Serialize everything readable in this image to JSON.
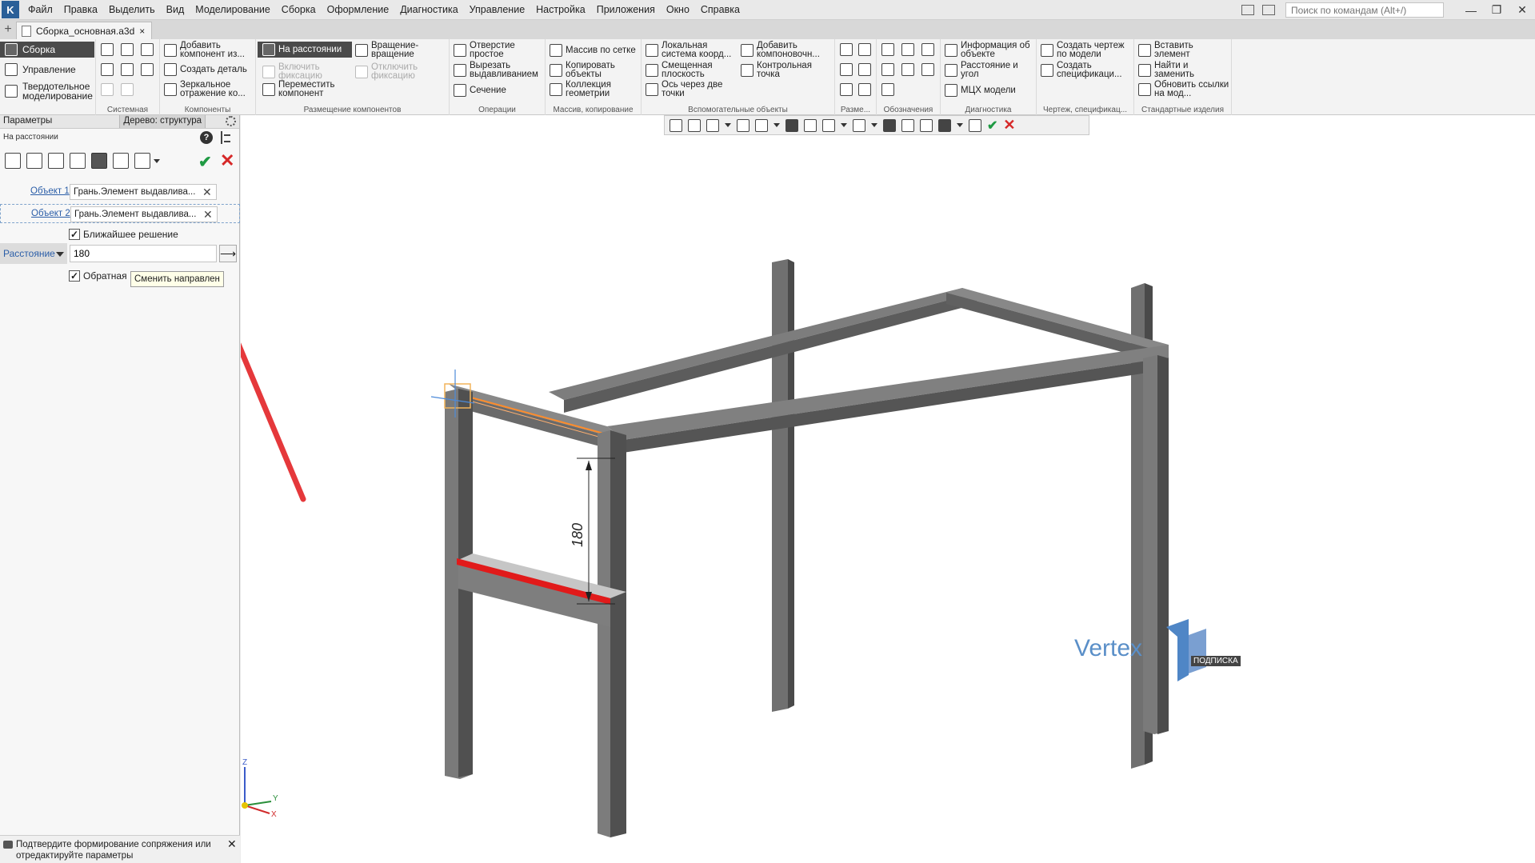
{
  "menu": {
    "items": [
      "Файл",
      "Правка",
      "Выделить",
      "Вид",
      "Моделирование",
      "Сборка",
      "Оформление",
      "Диагностика",
      "Управление",
      "Настройка",
      "Приложения",
      "Окно",
      "Справка"
    ],
    "search_placeholder": "Поиск по командам (Alt+/)"
  },
  "tab": {
    "title": "Сборка_основная.a3d",
    "close": "×",
    "new": "+"
  },
  "ribbon": {
    "modes": [
      {
        "label": "Сборка"
      },
      {
        "label": "Управление"
      },
      {
        "label": "Твердотельное моделирование"
      }
    ],
    "groups": {
      "system": "Системная",
      "components": "Компоненты",
      "placement": "Размещение компонентов",
      "operations": "Операции",
      "array": "Массив, копирование",
      "aux": "Вспомогательные объекты",
      "dims": "Разме...",
      "notation": "Обозначения",
      "diagnostics": "Диагностика",
      "drawing": "Чертеж, спецификац...",
      "standard": "Стандартные изделия"
    },
    "buttons": {
      "add_component": "Добавить компонент из...",
      "create_part": "Создать деталь",
      "mirror": "Зеркальное отражение ко...",
      "at_distance": "На расстоянии",
      "enable_fix": "Включить фиксацию",
      "move_component": "Переместить компонент",
      "rotate_rotate": "Вращение-вращение",
      "disable_fix": "Отключить фиксацию",
      "hole_simple": "Отверстие простое",
      "cut_extrude": "Вырезать выдавливанием",
      "section": "Сечение",
      "grid_array": "Массив по сетке",
      "copy_objects": "Копировать объекты",
      "geom_collection": "Коллекция геометрии",
      "local_cs": "Локальная система коорд...",
      "offset_plane": "Смещенная плоскость",
      "axis_two_points": "Ось через две точки",
      "add_layout": "Добавить компоновочн...",
      "control_point": "Контрольная точка",
      "object_info": "Информация об объекте",
      "distance_angle": "Расстояние и угол",
      "mcc_model": "МЦХ модели",
      "create_drawing": "Создать чертеж по модели",
      "create_spec": "Создать спецификаци...",
      "insert_element": "Вставить элемент",
      "find_replace": "Найти и заменить",
      "update_links": "Обновить ссылки на мод..."
    }
  },
  "left_panel": {
    "tab_params": "Параметры",
    "tab_tree": "Дерево: структура",
    "subtitle": "На расстоянии",
    "help": "?",
    "object1": {
      "label": "Объект 1",
      "value": "Грань.Элемент выдавлива..."
    },
    "object2": {
      "label": "Объект 2",
      "value": "Грань.Элемент выдавлива..."
    },
    "nearest_solution": "Ближайшее решение",
    "distance_label": "Расстояние",
    "distance_value": "180",
    "reverse_label": "Обратная",
    "tooltip": "Сменить направлен",
    "status_text": "Подтвердите формирование сопряжения или отредактируйте параметры"
  },
  "viewport": {
    "dimension_value": "180",
    "axis_x": "X",
    "axis_y": "Y",
    "axis_z": "Z",
    "watermark_sub": "ПОДПИСКА",
    "watermark_text": "Vertex"
  },
  "colors": {
    "accent_dark": "#4a4a4a",
    "ok_green": "#1f9a43",
    "cancel_red": "#d62828",
    "link_blue": "#2b5ea8",
    "arrow_red": "#e5383b",
    "frame_gray": "#6b6b6b"
  },
  "icons": {
    "ok": "✔",
    "cancel": "✕",
    "direction": "⟶"
  }
}
